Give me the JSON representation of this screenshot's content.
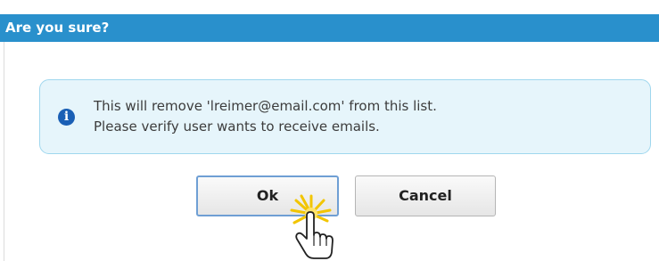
{
  "dialog": {
    "title": "Are you sure?",
    "message_line1": "This will remove 'lreimer@email.com' from this list.",
    "message_line2": "Please verify user wants to receive emails.",
    "info_icon": "info-icon",
    "info_glyph": "i"
  },
  "buttons": {
    "ok_label": "Ok",
    "cancel_label": "Cancel"
  },
  "cursor": {
    "icon": "hand-pointer-icon"
  },
  "colors": {
    "titlebar": "#2990cc",
    "info_background": "#e6f5fb",
    "info_border": "#9fd7ee",
    "info_icon": "#1a5fb5",
    "click_burst": "#f2c500"
  }
}
